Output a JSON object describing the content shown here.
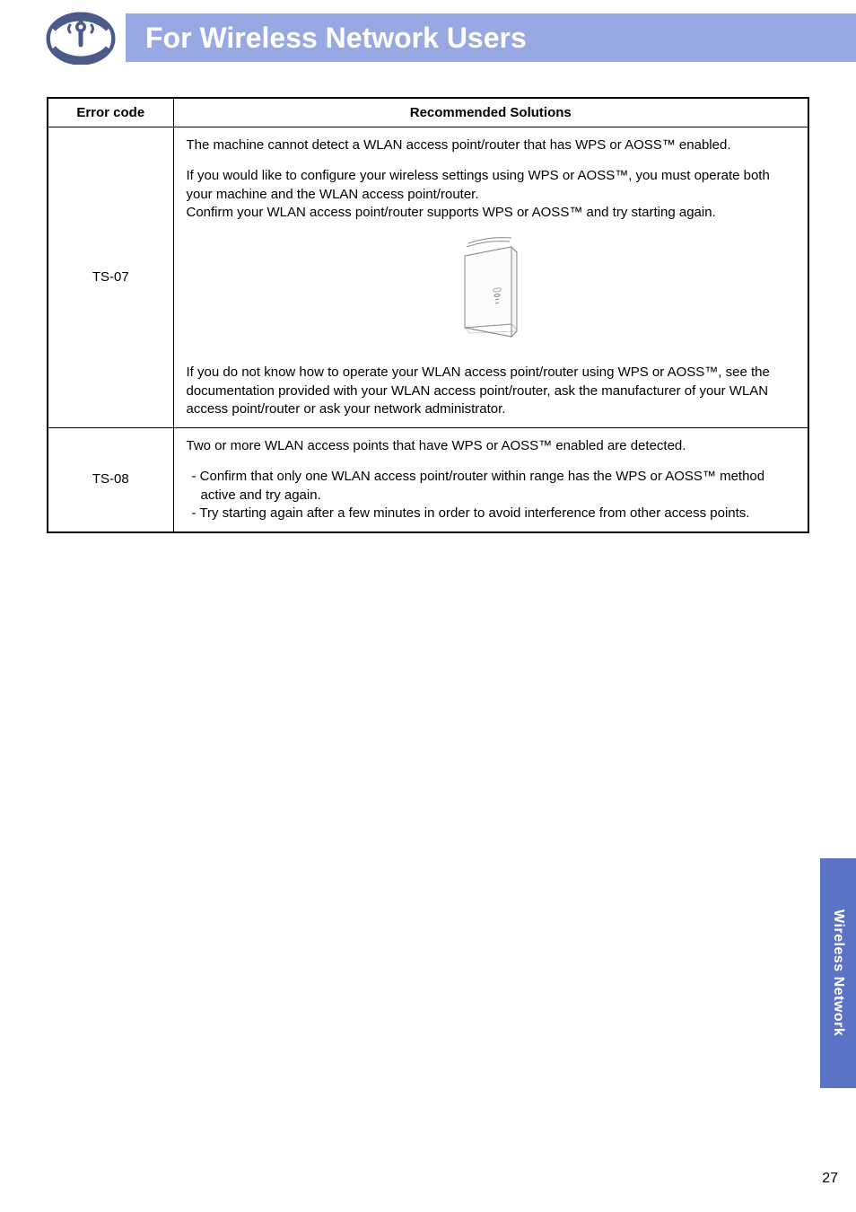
{
  "header": {
    "title": "For Wireless Network Users"
  },
  "table": {
    "headers": {
      "col1": "Error code",
      "col2": "Recommended Solutions"
    },
    "rows": [
      {
        "code": "TS-07",
        "p1": "The machine cannot detect a WLAN access point/router that has WPS or AOSS™ enabled.",
        "p2": "If you would like to configure your wireless settings using WPS or AOSS™, you must operate both your machine and the WLAN access point/router.",
        "p3": "Confirm your WLAN access point/router supports WPS or AOSS™ and try starting again.",
        "p4": "If you do not know how to operate your WLAN access point/router using WPS or AOSS™, see the documentation provided with your WLAN access point/router, ask the manufacturer of your WLAN access point/router or ask your network administrator."
      },
      {
        "code": "TS-08",
        "p1": "Two or more WLAN access points that have WPS or AOSS™ enabled are detected.",
        "li1": "- Confirm that only one WLAN access point/router within range has the WPS or AOSS™ method active and try again.",
        "li2": "- Try starting again after a few minutes in order to avoid interference from other access points."
      }
    ]
  },
  "sideTab": "Wireless Network",
  "pageNumber": "27"
}
